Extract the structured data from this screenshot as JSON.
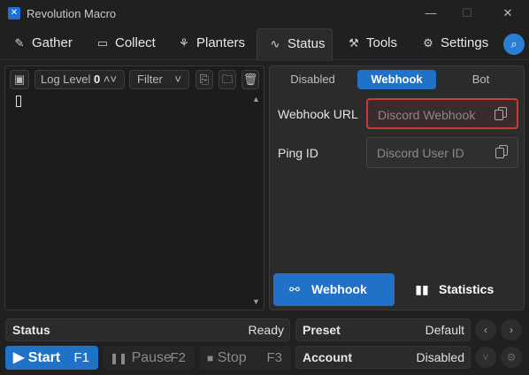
{
  "window": {
    "title": "Revolution Macro",
    "minimize": "—",
    "maximize": "☐",
    "close": "✕"
  },
  "tabs": [
    {
      "label": "Gather",
      "icon": "brush-icon",
      "glyph": "🖌"
    },
    {
      "label": "Collect",
      "icon": "ticket-icon",
      "glyph": "🎟"
    },
    {
      "label": "Planters",
      "icon": "sprout-icon",
      "glyph": "🌱"
    },
    {
      "label": "Status",
      "icon": "pulse-icon",
      "glyph": "∿"
    },
    {
      "label": "Tools",
      "icon": "wrench-icon",
      "glyph": "🔧"
    },
    {
      "label": "Settings",
      "icon": "gear-icon",
      "glyph": "⚙"
    }
  ],
  "active_tab": "Status",
  "log": {
    "level_label": "Log Level",
    "level_value": "0",
    "filter_label": "Filter"
  },
  "notify_modes": [
    "Disabled",
    "Webhook",
    "Bot"
  ],
  "active_mode": "Webhook",
  "fields": {
    "webhook_label": "Webhook URL",
    "webhook_placeholder": "Discord Webhook",
    "ping_label": "Ping ID",
    "ping_placeholder": "Discord User ID"
  },
  "buttons": {
    "webhook": "Webhook",
    "statistics": "Statistics"
  },
  "status": {
    "label": "Status",
    "value": "Ready"
  },
  "preset": {
    "label": "Preset",
    "value": "Default"
  },
  "account": {
    "label": "Account",
    "value": "Disabled"
  },
  "controls": {
    "start": "Start",
    "start_key": "F1",
    "pause": "Pause",
    "pause_key": "F2",
    "stop": "Stop",
    "stop_key": "F3"
  },
  "colors": {
    "accent": "#1f72c8",
    "invalid_border": "#c93a3a"
  }
}
